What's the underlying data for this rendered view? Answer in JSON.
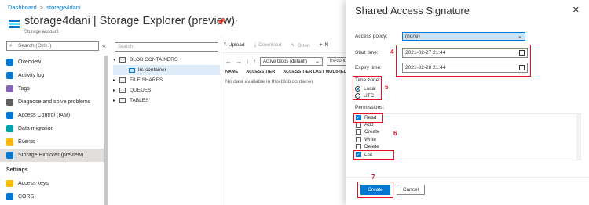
{
  "breadcrumb": [
    "Dashboard",
    "storage4dani"
  ],
  "resource": {
    "title": "storage4dani",
    "subtitle": "| Storage Explorer (preview)",
    "type": "Storage account",
    "more": "···"
  },
  "sidebar": {
    "search_placeholder": "Search (Ctrl+/)",
    "collapse": "«",
    "items": [
      {
        "label": "Overview",
        "color": "#0078d4"
      },
      {
        "label": "Activity log",
        "color": "#0078d4"
      },
      {
        "label": "Tags",
        "color": "#8764b8"
      },
      {
        "label": "Diagnose and solve problems",
        "color": "#605e5c"
      },
      {
        "label": "Access Control (IAM)",
        "color": "#0078d4"
      },
      {
        "label": "Data migration",
        "color": "#00a2ad"
      },
      {
        "label": "Events",
        "color": "#ffb900"
      },
      {
        "label": "Storage Explorer (preview)",
        "color": "#0078d4"
      }
    ],
    "section_settings": "Settings",
    "settings_items": [
      {
        "label": "Access keys",
        "color": "#ffb900"
      },
      {
        "label": "CORS",
        "color": "#0078d4"
      }
    ]
  },
  "explorer": {
    "search_placeholder": "Search",
    "tree": [
      {
        "label": "BLOB CONTAINERS",
        "caret": "▾"
      },
      {
        "label": "lrs-container",
        "caret": ""
      },
      {
        "label": "FILE SHARES",
        "caret": "▸"
      },
      {
        "label": "QUEUES",
        "caret": "▸"
      },
      {
        "label": "TABLES",
        "caret": "▸"
      }
    ],
    "toolbar": {
      "upload": "Upload",
      "download": "Download",
      "open": "Open",
      "new": "N"
    },
    "blob_filter": "Active blobs (default)",
    "path": "lrs-cont",
    "columns": [
      "NAME",
      "ACCESS TIER",
      "ACCESS TIER LAST MODIFIED"
    ],
    "empty_text": "No data available in this blob container"
  },
  "dialog": {
    "title": "Shared Access Signature",
    "close": "✕",
    "access_policy_label": "Access policy:",
    "access_policy_value": "(none)",
    "start_label": "Start time:",
    "start_value": "2021-02-27  21:44",
    "expiry_label": "Expiry time:",
    "expiry_value": "2021-02-28  21:44",
    "timezone_label": "Time zone:",
    "timezone_options": [
      "Local",
      "UTC"
    ],
    "permissions_label": "Permissions:",
    "permissions": [
      {
        "label": "Read",
        "checked": true
      },
      {
        "label": "Add",
        "checked": false
      },
      {
        "label": "Create",
        "checked": false
      },
      {
        "label": "Write",
        "checked": false
      },
      {
        "label": "Delete",
        "checked": false
      },
      {
        "label": "List",
        "checked": true
      }
    ],
    "create_label": "Create",
    "cancel_label": "Cancel",
    "annotations": [
      "4",
      "5",
      "6",
      "7"
    ],
    "annotation_color": "#e81123"
  }
}
